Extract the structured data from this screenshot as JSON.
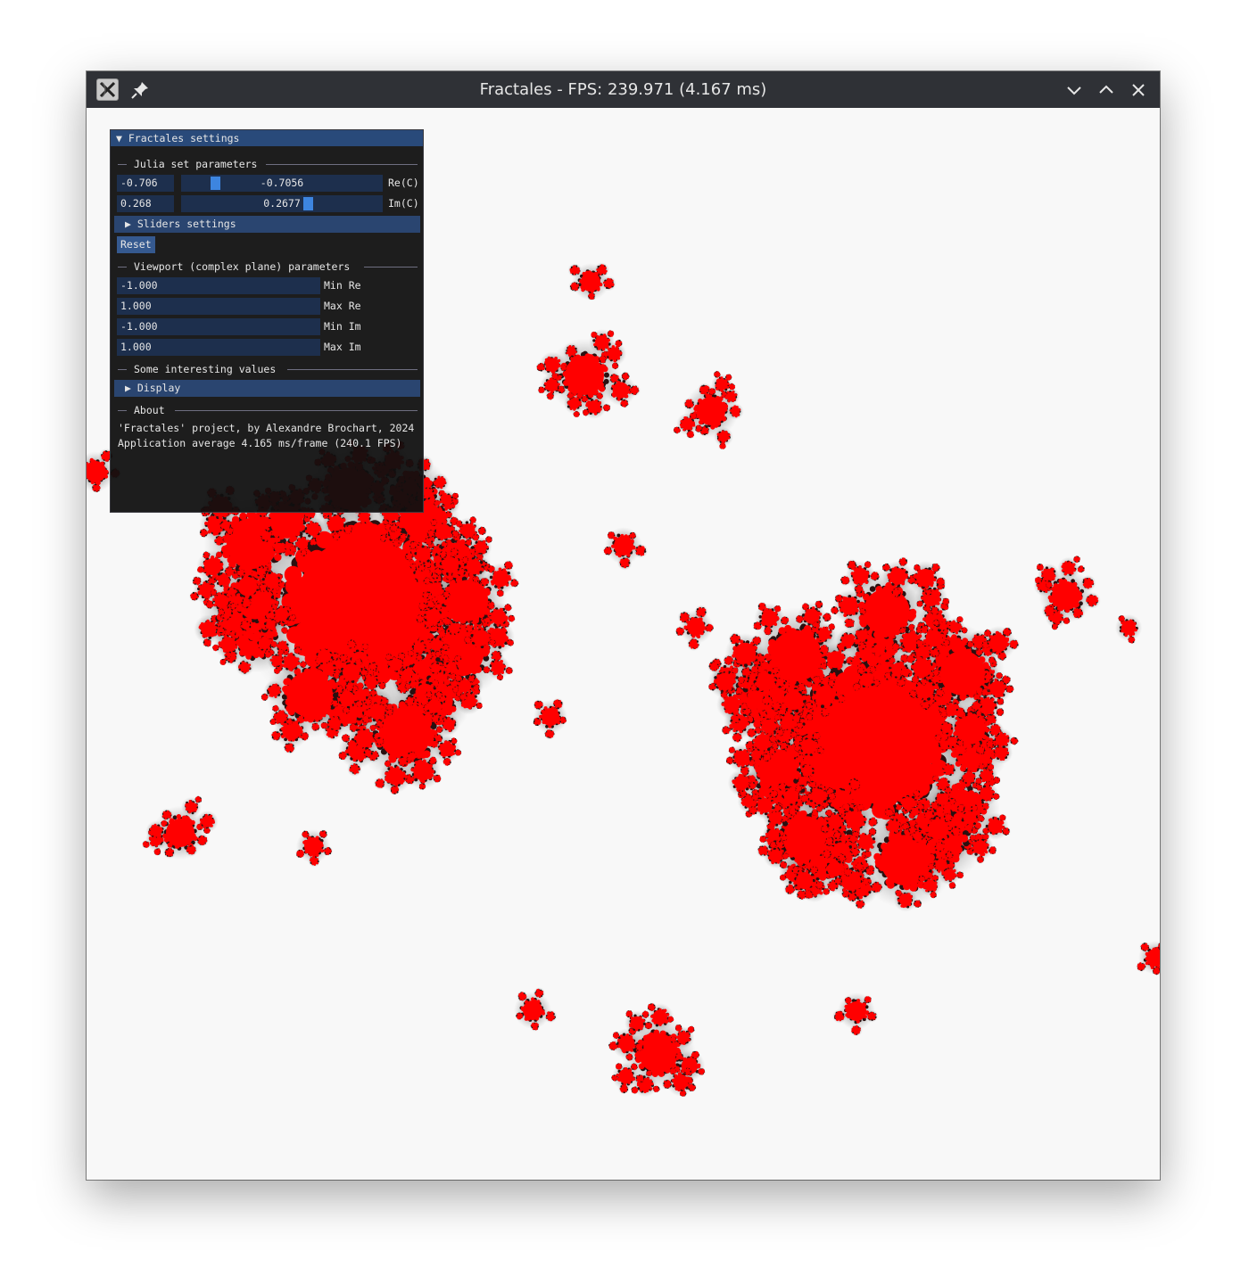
{
  "window": {
    "title": "Fractales - FPS: 239.971 (4.167 ms)"
  },
  "panel": {
    "title": "Fractales settings",
    "julia": {
      "header": "Julia set parameters",
      "re_input": "-0.706",
      "re_slider": "-0.7056",
      "re_label": "Re(C)",
      "im_input": "0.268",
      "im_slider": "0.2677",
      "im_label": "Im(C)"
    },
    "sliders_settings": "Sliders settings",
    "reset": "Reset",
    "viewport": {
      "header": "Viewport (complex plane) parameters",
      "min_re": "-1.000",
      "min_re_label": "Min Re",
      "max_re": "1.000",
      "max_re_label": "Max Re",
      "min_im": "-1.000",
      "min_im_label": "Min Im",
      "max_im": "1.000",
      "max_im_label": "Max Im"
    },
    "interesting": "Some interesting values",
    "display": "Display",
    "about": {
      "header": "About",
      "line1": "'Fractales' project, by Alexandre Brochart, 2024",
      "line2": "Application average 4.165 ms/frame (240.1 FPS)"
    }
  },
  "colors": {
    "fractal_fill": "#ff0000",
    "background": "#f8f8f8",
    "titlebar": "#2f3136",
    "panel_title": "#294a7a",
    "frame_bg": "#1d2f4d",
    "slider_grab": "#3d85e0"
  },
  "icons": {
    "app": "x-app-icon",
    "pin": "pin-icon",
    "minimize": "chevron-down-icon",
    "maximize": "chevron-up-icon",
    "close": "close-icon"
  }
}
